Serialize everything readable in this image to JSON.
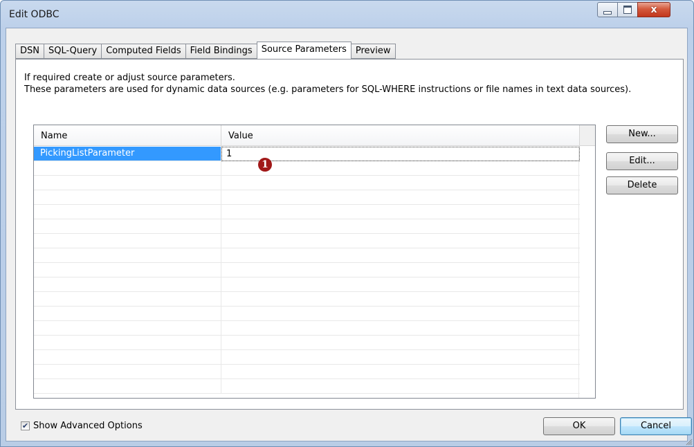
{
  "window": {
    "title": "Edit ODBC",
    "close_glyph": "x"
  },
  "tabs": [
    {
      "label": "DSN"
    },
    {
      "label": "SQL-Query"
    },
    {
      "label": "Computed Fields"
    },
    {
      "label": "Field Bindings"
    },
    {
      "label": "Source Parameters",
      "active": true
    },
    {
      "label": "Preview"
    }
  ],
  "description": {
    "line1": "If required create or adjust source parameters.",
    "line2": "These parameters are used for dynamic data sources (e.g. parameters for SQL-WHERE instructions or file names in text data sources)."
  },
  "grid": {
    "columns": {
      "name": "Name",
      "value": "Value"
    },
    "rows": [
      {
        "name": "PickingListParameter",
        "value": "1",
        "selected": true
      }
    ]
  },
  "marker": {
    "label": "1"
  },
  "buttons": {
    "new": "New...",
    "edit": "Edit...",
    "delete": "Delete",
    "ok": "OK",
    "cancel": "Cancel"
  },
  "options": {
    "show_advanced": "Show Advanced Options",
    "show_advanced_checked": true
  },
  "colors": {
    "selection": "#3399ff",
    "marker": "#a11818",
    "title_bar": "#bcd0ea"
  }
}
